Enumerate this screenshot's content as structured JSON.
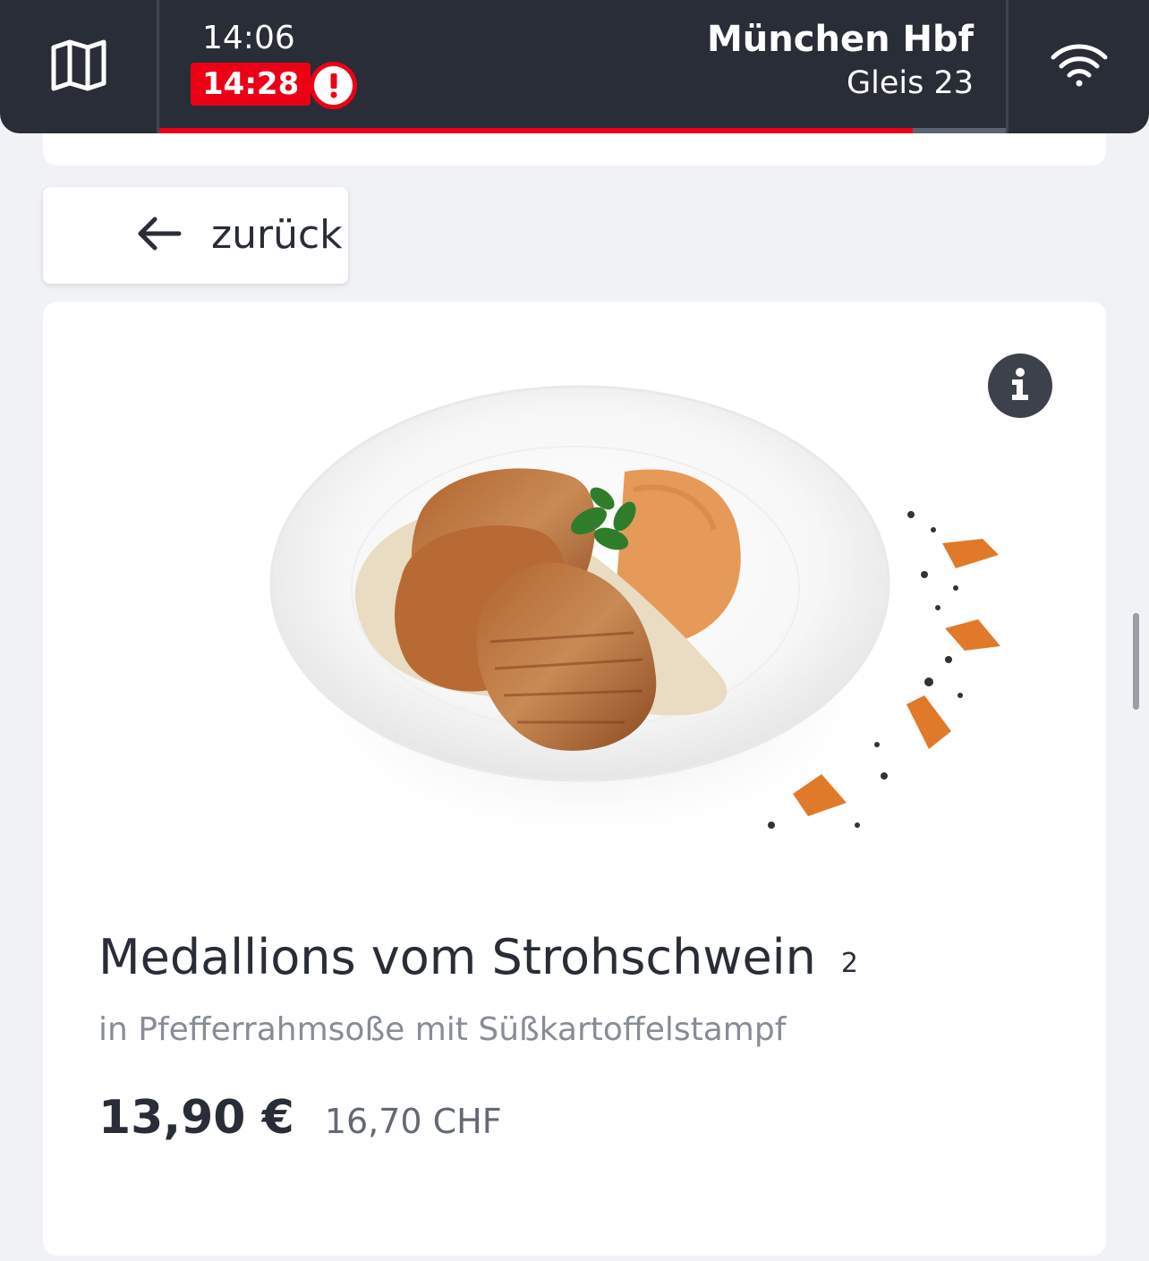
{
  "header": {
    "map_icon": "map-icon",
    "planned_time": "14:06",
    "actual_time": "14:28",
    "alert_icon": "alert-icon",
    "station": "München Hbf",
    "platform": "Gleis 23",
    "wifi_icon": "wifi-icon",
    "progress_fraction": 0.89,
    "colors": {
      "bar_bg": "#282d37",
      "delay_red": "#ec0016"
    }
  },
  "back_button": {
    "icon": "arrow-left-icon",
    "label": "zurück"
  },
  "product": {
    "info_icon": "info-icon",
    "image": "medallions-plate-image",
    "title": "Medallions vom Strohschwein",
    "allergen_note": "2",
    "description": "in Pfefferrahmsoße mit Süßkartoffelstampf",
    "price_eur": "13,90 €",
    "price_chf": "16,70 CHF"
  }
}
